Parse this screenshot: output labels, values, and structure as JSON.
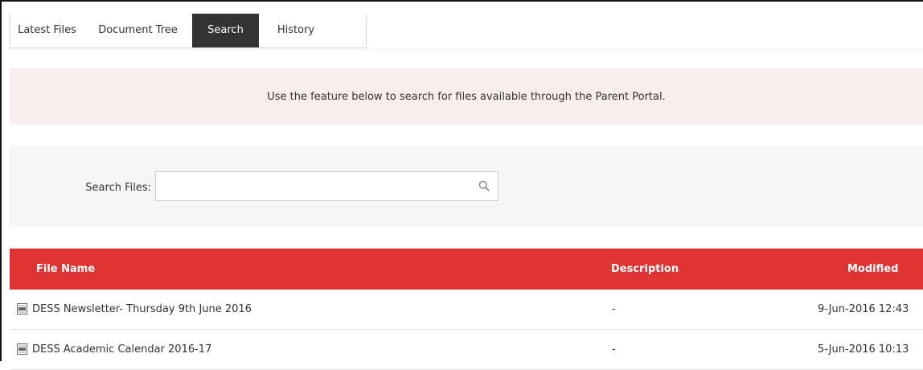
{
  "tabs": [
    "Latest Files",
    "Document Tree",
    "Search",
    "History"
  ],
  "active_tab": "Search",
  "notice": "Use the feature below to search for files available through the Parent Portal.",
  "search": {
    "label": "Search Files:",
    "value": "",
    "placeholder": ""
  },
  "table": {
    "headers": {
      "name": "File Name",
      "description": "Description",
      "modified": "Modified"
    },
    "rows": [
      {
        "name": "DESS Newsletter- Thursday 9th June 2016",
        "description": "-",
        "modified": "9-Jun-2016 12:43"
      },
      {
        "name": "DESS Academic Calendar 2016-17",
        "description": "-",
        "modified": "5-Jun-2016 10:13"
      }
    ]
  },
  "colors": {
    "header_red": "#df3434",
    "notice_bg": "#f8eeee",
    "active_tab_bg": "#333333"
  }
}
